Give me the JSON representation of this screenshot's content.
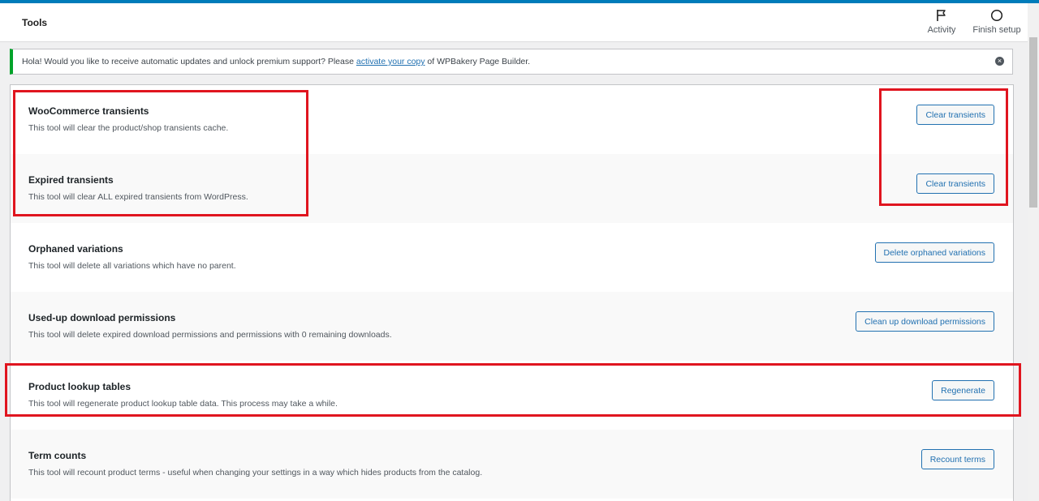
{
  "header": {
    "title": "Tools",
    "actions": [
      {
        "label": "Activity",
        "icon": "flag-icon"
      },
      {
        "label": "Finish setup",
        "icon": "circle-icon"
      }
    ]
  },
  "notice": {
    "text_before": "Hola! Would you like to receive automatic updates and unlock premium support? Please ",
    "link_text": "activate your copy",
    "text_after": " of WPBakery Page Builder.",
    "close_icon": "close-icon"
  },
  "tools": [
    {
      "name": "WooCommerce transients",
      "description": "This tool will clear the product/shop transients cache.",
      "button": "Clear transients"
    },
    {
      "name": "Expired transients",
      "description": "This tool will clear ALL expired transients from WordPress.",
      "button": "Clear transients"
    },
    {
      "name": "Orphaned variations",
      "description": "This tool will delete all variations which have no parent.",
      "button": "Delete orphaned variations"
    },
    {
      "name": "Used-up download permissions",
      "description": "This tool will delete expired download permissions and permissions with 0 remaining downloads.",
      "button": "Clean up download permissions"
    },
    {
      "name": "Product lookup tables",
      "description": "This tool will regenerate product lookup table data. This process may take a while.",
      "button": "Regenerate"
    },
    {
      "name": "Term counts",
      "description": "This tool will recount product terms - useful when changing your settings in a way which hides products from the catalog.",
      "button": "Recount terms"
    }
  ],
  "colors": {
    "accent": "#2271b1",
    "topbar": "#007cba",
    "notice_border": "#00a32a",
    "highlight": "#e0151f"
  }
}
